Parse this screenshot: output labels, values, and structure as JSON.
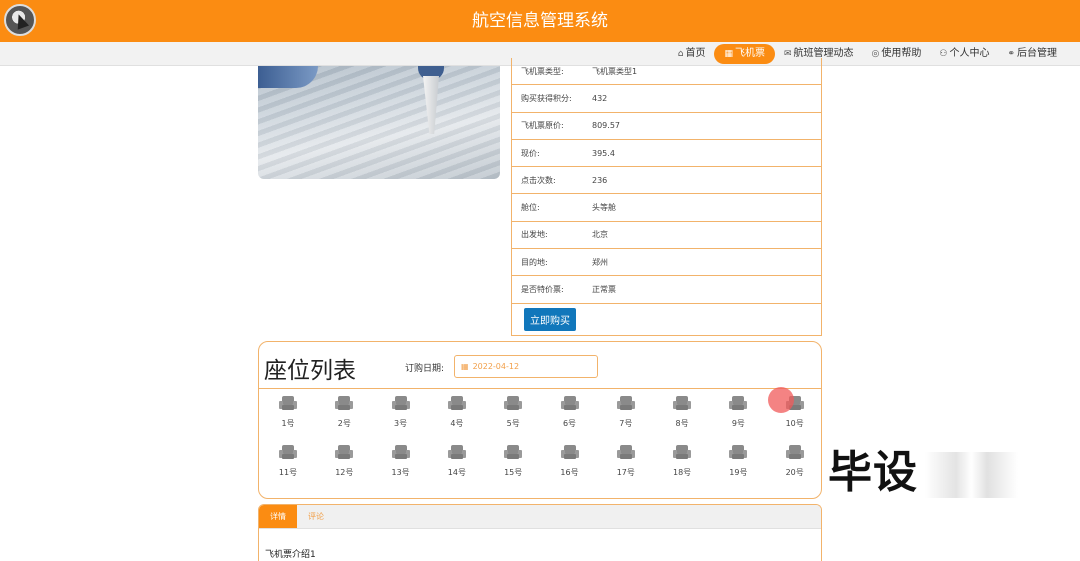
{
  "header": {
    "title": "航空信息管理系统"
  },
  "nav": [
    {
      "icon": "⌂",
      "label": "首页",
      "active": false
    },
    {
      "icon": "▦",
      "label": "飞机票",
      "active": true
    },
    {
      "icon": "✉",
      "label": "航班管理动态",
      "active": false
    },
    {
      "icon": "◎",
      "label": "使用帮助",
      "active": false
    },
    {
      "icon": "⚇",
      "label": "个人中心",
      "active": false
    },
    {
      "icon": "⚭",
      "label": "后台管理",
      "active": false
    }
  ],
  "info_rows": [
    {
      "key": "飞机票类型:",
      "value": "飞机票类型1"
    },
    {
      "key": "购买获得积分:",
      "value": "432"
    },
    {
      "key": "飞机票原价:",
      "value": "809.57"
    },
    {
      "key": "现价:",
      "value": "395.4"
    },
    {
      "key": "点击次数:",
      "value": "236"
    },
    {
      "key": "舱位:",
      "value": "头等舱"
    },
    {
      "key": "出发地:",
      "value": "北京"
    },
    {
      "key": "目的地:",
      "value": "郑州"
    },
    {
      "key": "是否特价票:",
      "value": "正常票"
    }
  ],
  "buy_label": "立即购买",
  "seats": {
    "title": "座位列表",
    "date_label": "订购日期:",
    "date_value": "2022-04-12",
    "items": [
      "1号",
      "2号",
      "3号",
      "4号",
      "5号",
      "6号",
      "7号",
      "8号",
      "9号",
      "10号",
      "11号",
      "12号",
      "13号",
      "14号",
      "15号",
      "16号",
      "17号",
      "18号",
      "19号",
      "20号"
    ]
  },
  "watermark": "毕设",
  "detail": {
    "tabs": [
      {
        "label": "详情",
        "active": true
      },
      {
        "label": "评论",
        "active": false
      }
    ],
    "text": "飞机票介绍1"
  },
  "colors": {
    "accent": "#fb8c12",
    "border": "#f2b36b",
    "button": "#1177bb"
  }
}
